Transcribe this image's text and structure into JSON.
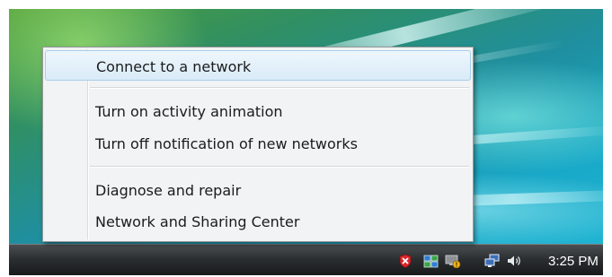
{
  "menu": {
    "items": [
      {
        "label": "Connect to a network"
      },
      {
        "label": "Turn on activity animation"
      },
      {
        "label": "Turn off notification of new networks"
      },
      {
        "label": "Diagnose and repair"
      },
      {
        "label": "Network and Sharing Center"
      }
    ]
  },
  "taskbar": {
    "clock": "3:25 PM",
    "tray_icons": [
      "shield-warning-icon",
      "monitor-icon",
      "monitor-warning-icon",
      "network-icon",
      "volume-icon"
    ]
  },
  "colors": {
    "menu_background": "#f1f3f4",
    "menu_highlight": "#d9ebf8",
    "taskbar": "#2c2f31",
    "shield_red": "#d8262a"
  }
}
